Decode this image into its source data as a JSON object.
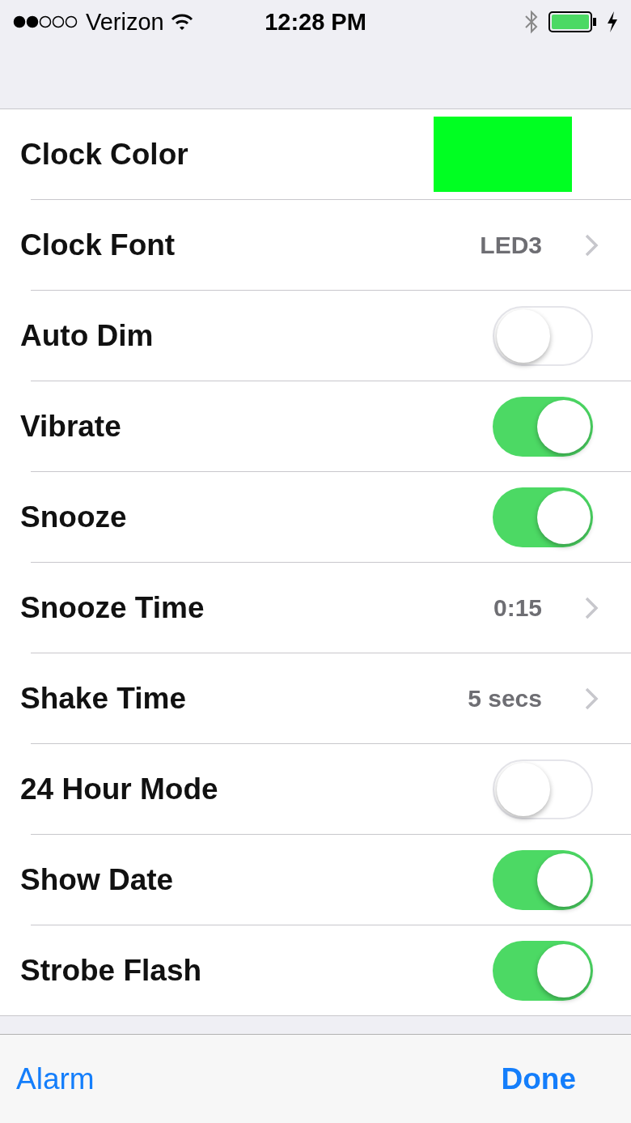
{
  "status_bar": {
    "carrier": "Verizon",
    "time": "12:28 PM"
  },
  "settings": [
    {
      "kind": "color",
      "label": "Clock Color",
      "color": "#00ff22"
    },
    {
      "kind": "disclosure",
      "label": "Clock Font",
      "value": "LED3"
    },
    {
      "kind": "toggle",
      "label": "Auto Dim",
      "on": false
    },
    {
      "kind": "toggle",
      "label": "Vibrate",
      "on": true
    },
    {
      "kind": "toggle",
      "label": "Snooze",
      "on": true
    },
    {
      "kind": "disclosure",
      "label": "Snooze Time",
      "value": "0:15"
    },
    {
      "kind": "disclosure",
      "label": "Shake Time",
      "value": "5 secs"
    },
    {
      "kind": "toggle",
      "label": "24 Hour Mode",
      "on": false
    },
    {
      "kind": "toggle",
      "label": "Show Date",
      "on": true
    },
    {
      "kind": "toggle",
      "label": "Strobe Flash",
      "on": true
    }
  ],
  "toolbar": {
    "left_button": "Alarm",
    "right_button": "Done"
  }
}
